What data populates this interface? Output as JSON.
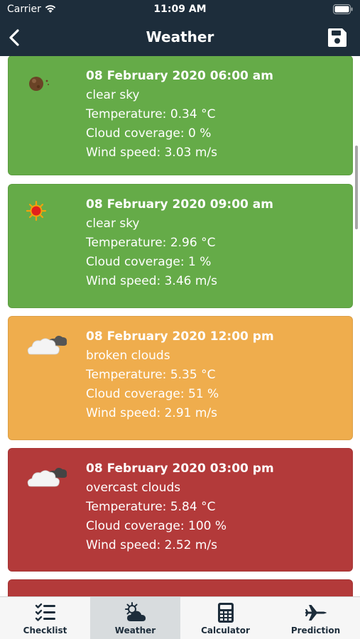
{
  "status_bar": {
    "carrier": "Carrier",
    "time": "11:09 AM"
  },
  "nav": {
    "title": "Weather"
  },
  "forecasts": [
    {
      "date": "08 February 2020 06:00 am",
      "description": "clear sky",
      "temperature": "Temperature: 0.34 °C",
      "cloud": "Cloud coverage: 0 %",
      "wind": "Wind speed: 3.03 m/s",
      "icon": "moon-icon",
      "color": "#65ab48"
    },
    {
      "date": "08 February 2020 09:00 am",
      "description": "clear sky",
      "temperature": "Temperature: 2.96 °C",
      "cloud": "Cloud coverage: 1 %",
      "wind": "Wind speed: 3.46 m/s",
      "icon": "sun-icon",
      "color": "#65ab48"
    },
    {
      "date": "08 February 2020 12:00 pm",
      "description": "broken clouds",
      "temperature": "Temperature: 5.35 °C",
      "cloud": "Cloud coverage: 51 %",
      "wind": "Wind speed: 2.91 m/s",
      "icon": "broken-clouds-icon",
      "color": "#efad4d"
    },
    {
      "date": "08 February 2020 03:00 pm",
      "description": "overcast clouds",
      "temperature": "Temperature: 5.84 °C",
      "cloud": "Cloud coverage: 100 %",
      "wind": "Wind speed: 2.52 m/s",
      "icon": "overcast-clouds-icon",
      "color": "#b33a3a"
    },
    {
      "color": "#b33a3a"
    }
  ],
  "tabs": [
    {
      "label": "Checklist",
      "icon": "checklist-icon",
      "active": false
    },
    {
      "label": "Weather",
      "icon": "weather-icon",
      "active": true
    },
    {
      "label": "Calculator",
      "icon": "calculator-icon",
      "active": false
    },
    {
      "label": "Prediction",
      "icon": "airplane-icon",
      "active": false
    }
  ]
}
